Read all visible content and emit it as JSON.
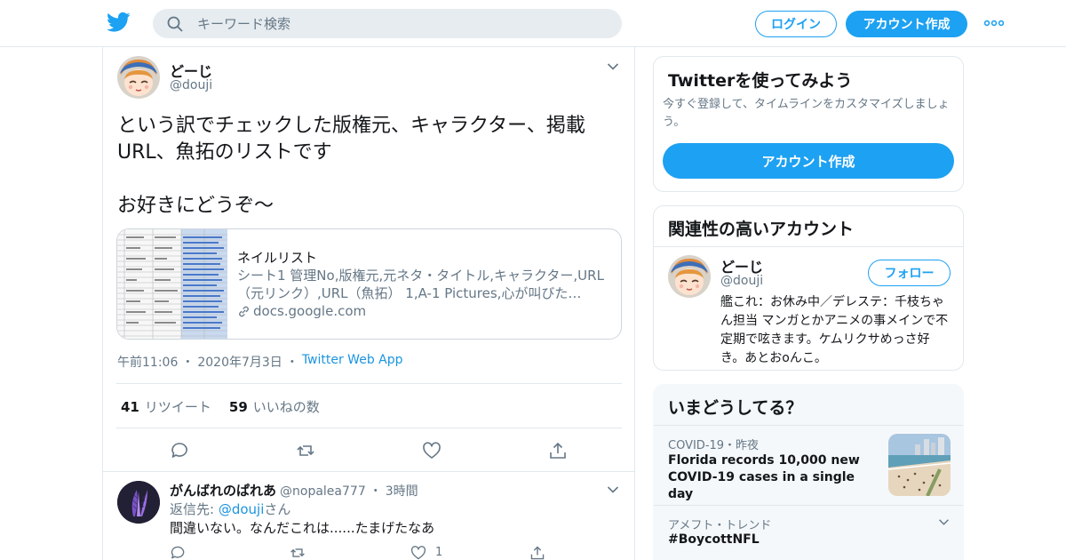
{
  "header": {
    "search_placeholder": "キーワード検索",
    "login_label": "ログイン",
    "signup_label": "アカウント作成",
    "brand_color": "#1da1f2"
  },
  "tweet": {
    "name": "どーじ",
    "handle": "@douji",
    "text": "という訳でチェックした版権元、キャラクター、掲載URL、魚拓のリストです\n\nお好きにどうぞ～",
    "card": {
      "title": "ネイルリスト",
      "description": "シート1 管理No,版権元,元ネタ・タイトル,キャラクター,URL（元リンク）,URL（魚拓） 1,A-1 Pictures,心が叫びた…",
      "domain": "docs.google.com"
    },
    "time": "午前11:06",
    "date": "2020年7月3日",
    "app": "Twitter Web App",
    "retweets": {
      "count": "41",
      "label": "リツイート"
    },
    "likes": {
      "count": "59",
      "label": "いいねの数"
    }
  },
  "reply": {
    "name": "がんばれのぱれあ",
    "handle": "@nopalea777",
    "time": "3時間",
    "reply_prefix": "返信先: ",
    "reply_mention": "@douji",
    "reply_suffix": "さん",
    "text": "間違いない。なんだこれは......たまげたなあ",
    "like_count": "1"
  },
  "sidebar": {
    "signup_box": {
      "title": "Twitterを使ってみよう",
      "description": "今すぐ登録して、タイムラインをカスタマイズしましょう。",
      "button": "アカウント作成"
    },
    "related": {
      "title": "関連性の高いアカウント",
      "name": "どーじ",
      "handle": "@douji",
      "follow_label": "フォロー",
      "bio": "艦これ：お休み中／デレステ：千枝ちゃん担当 マンガとかアニメの事メインで不定期で呟きます。ケムリクサめっさ好き。あとおoんこ。"
    },
    "trends": {
      "title": "いまどうしてる？",
      "items": [
        {
          "meta": "COVID-19・昨夜",
          "title": "Florida records 10,000 new COVID-19 cases in a single day"
        },
        {
          "meta": "アメフト・トレンド",
          "title": "#BoycottNFL"
        }
      ]
    }
  }
}
